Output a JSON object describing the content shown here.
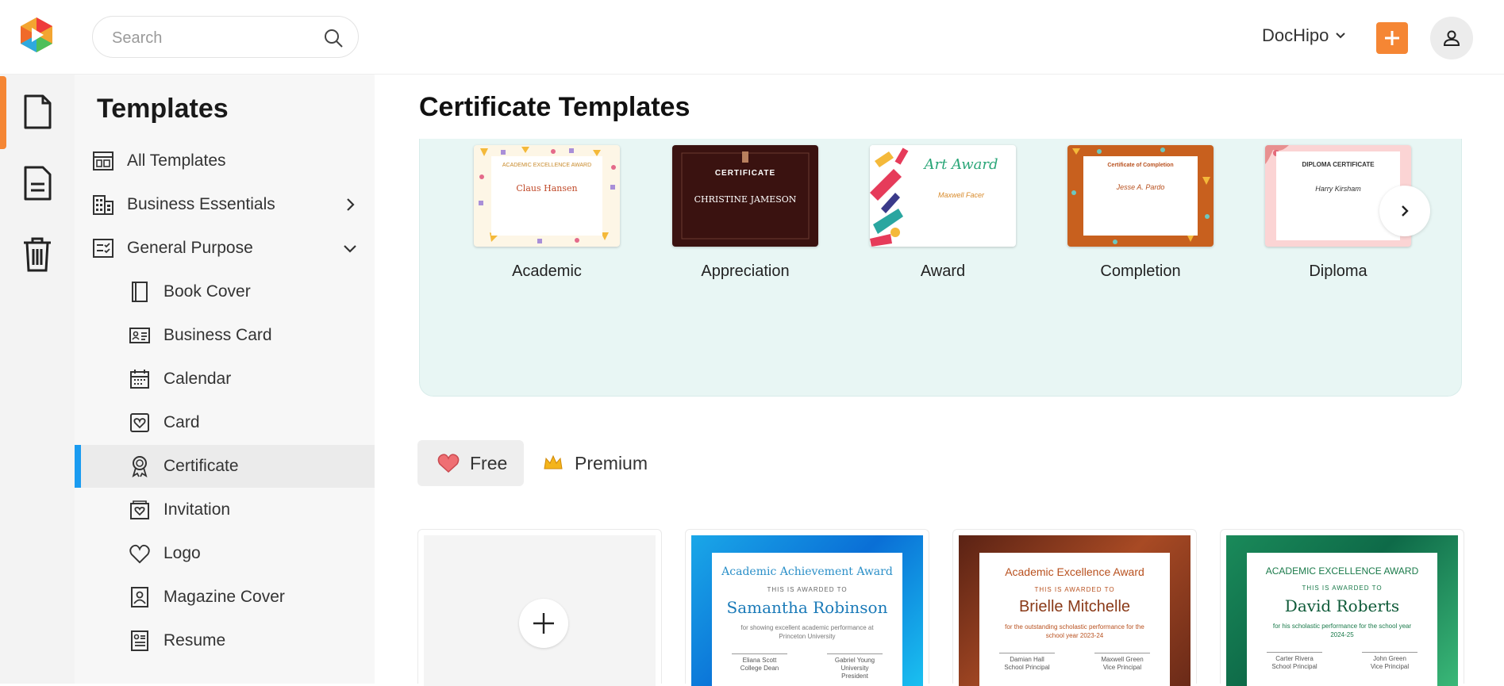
{
  "header": {
    "search_placeholder": "Search",
    "brand": "DocHipo",
    "accent_color": "#f58634"
  },
  "sidebar": {
    "title": "Templates",
    "items": [
      {
        "label": "All Templates",
        "icon": "layout-icon"
      },
      {
        "label": "Business Essentials",
        "icon": "building-icon"
      },
      {
        "label": "General Purpose",
        "icon": "checklist-icon"
      },
      {
        "label": "Book Cover",
        "icon": "book-icon"
      },
      {
        "label": "Business Card",
        "icon": "id-card-icon"
      },
      {
        "label": "Calendar",
        "icon": "calendar-icon"
      },
      {
        "label": "Card",
        "icon": "heart-card-icon"
      },
      {
        "label": "Certificate",
        "icon": "ribbon-icon"
      },
      {
        "label": "Invitation",
        "icon": "envelope-heart-icon"
      },
      {
        "label": "Logo",
        "icon": "heart-icon"
      },
      {
        "label": "Magazine Cover",
        "icon": "magazine-icon"
      },
      {
        "label": "Resume",
        "icon": "resume-icon"
      }
    ]
  },
  "main": {
    "title": "Certificate Templates",
    "categories": [
      {
        "label": "Academic"
      },
      {
        "label": "Appreciation"
      },
      {
        "label": "Award"
      },
      {
        "label": "Completion"
      },
      {
        "label": "Diploma"
      }
    ],
    "thumb_text": {
      "academic": {
        "title": "ACADEMIC EXCELLENCE AWARD",
        "name": "Claus Hansen"
      },
      "appreciation": {
        "title": "CERTIFICATE",
        "name": "CHRISTINE JAMESON"
      },
      "award": {
        "title": "Art Award",
        "name": "Maxwell Facer"
      },
      "completion": {
        "title": "Certificate of Completion",
        "name": "Jesse A. Pardo"
      },
      "diploma": {
        "title": "DIPLOMA CERTIFICATE",
        "name": "Harry Kirsham"
      }
    },
    "filters": {
      "free": "Free",
      "premium": "Premium"
    },
    "templates": [
      {
        "title": "Academic Achievement Award",
        "sub": "THIS IS AWARDED TO",
        "name": "Samantha Robinson",
        "desc": "for showing excellent academic performance at Princeton University",
        "sign1": "Eliana Scott",
        "sign1_role": "College Dean",
        "sign2": "Gabriel Young",
        "sign2_role": "University President"
      },
      {
        "title": "Academic Excellence Award",
        "sub": "THIS IS AWARDED TO",
        "name": "Brielle Mitchelle",
        "desc": "for the outstanding scholastic performance for the school year 2023-24",
        "sign1": "Damian Hall",
        "sign1_role": "School Principal",
        "sign2": "Maxwell Green",
        "sign2_role": "Vice Principal"
      },
      {
        "title": "ACADEMIC EXCELLENCE AWARD",
        "sub": "THIS IS AWARDED TO",
        "name": "David Roberts",
        "desc": "for his scholastic performance for the school year 2024-25",
        "sign1": "Carter Rivera",
        "sign1_role": "School Principal",
        "sign2": "John Green",
        "sign2_role": "Vice Principal"
      }
    ]
  }
}
